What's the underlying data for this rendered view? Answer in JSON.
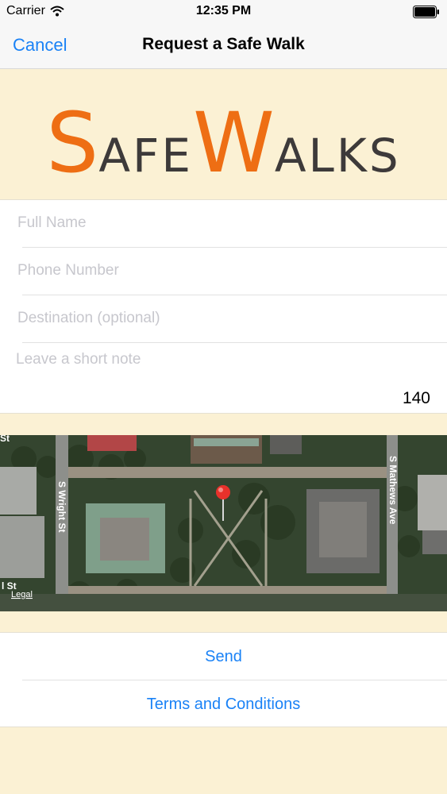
{
  "status_bar": {
    "carrier": "Carrier",
    "time": "12:35 PM"
  },
  "nav": {
    "cancel_label": "Cancel",
    "title": "Request a Safe Walk"
  },
  "logo": {
    "s": "S",
    "afe": "AFE",
    "w": "W",
    "alks": "ALKS",
    "primary_color": "#ee6e14",
    "secondary_color": "#3d3a3a"
  },
  "form": {
    "full_name": {
      "value": "",
      "placeholder": "Full Name"
    },
    "phone": {
      "value": "",
      "placeholder": "Phone Number"
    },
    "destination": {
      "value": "",
      "placeholder": "Destination (optional)"
    },
    "note": {
      "value": "",
      "placeholder": "Leave a short note"
    },
    "char_remaining": "140"
  },
  "map": {
    "street_labels": [
      "S Wright St",
      "S Mathews Ave",
      "l St",
      "St",
      "Legal"
    ],
    "pin_color": "#e8312b"
  },
  "actions": {
    "send_label": "Send",
    "terms_label": "Terms and Conditions"
  },
  "colors": {
    "accent": "#1a82f6",
    "background": "#fbf1d4"
  }
}
